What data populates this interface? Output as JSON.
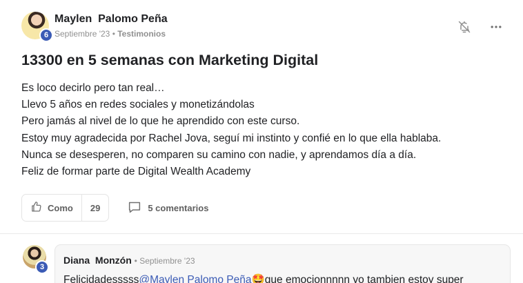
{
  "post": {
    "author": "Maylen  Palomo Peña",
    "level": "6",
    "date": "Septiembre '23",
    "separator": "•",
    "category": "Testimonios",
    "title": "13300 en 5 semanas con Marketing Digital",
    "body_lines": [
      "Es loco decirlo pero tan real…",
      "Llevo 5 años en redes sociales y monetizándolas",
      "Pero jamás al nivel de lo que he aprendido con este curso.",
      "Estoy muy agradecida por Rachel Jova, seguí mi instinto y confié en lo que ella hablaba.",
      "Nunca se desesperen, no comparen su camino con nadie, y aprendamos día a día.",
      "Feliz de formar parte de Digital Wealth Academy"
    ],
    "like_label": "Como",
    "like_count": "29",
    "comments_label": "5 comentarios"
  },
  "icons": {
    "bell": "bell-off-icon",
    "more": "more-horizontal-icon",
    "like": "thumbs-up-icon",
    "comment": "chat-bubble-icon"
  },
  "comment": {
    "author": "Diana  Monzón",
    "level": "3",
    "date_prefix": "• Septiembre '23",
    "text_before": "Felicidadesssss",
    "mention": "@Maylen Palomo Peña",
    "emoji": "🤩",
    "text_after": "que emocionnnnn yo tambien estoy super"
  },
  "colors": {
    "accent": "#3b5bb5",
    "muted": "#909090",
    "text": "#202124"
  }
}
